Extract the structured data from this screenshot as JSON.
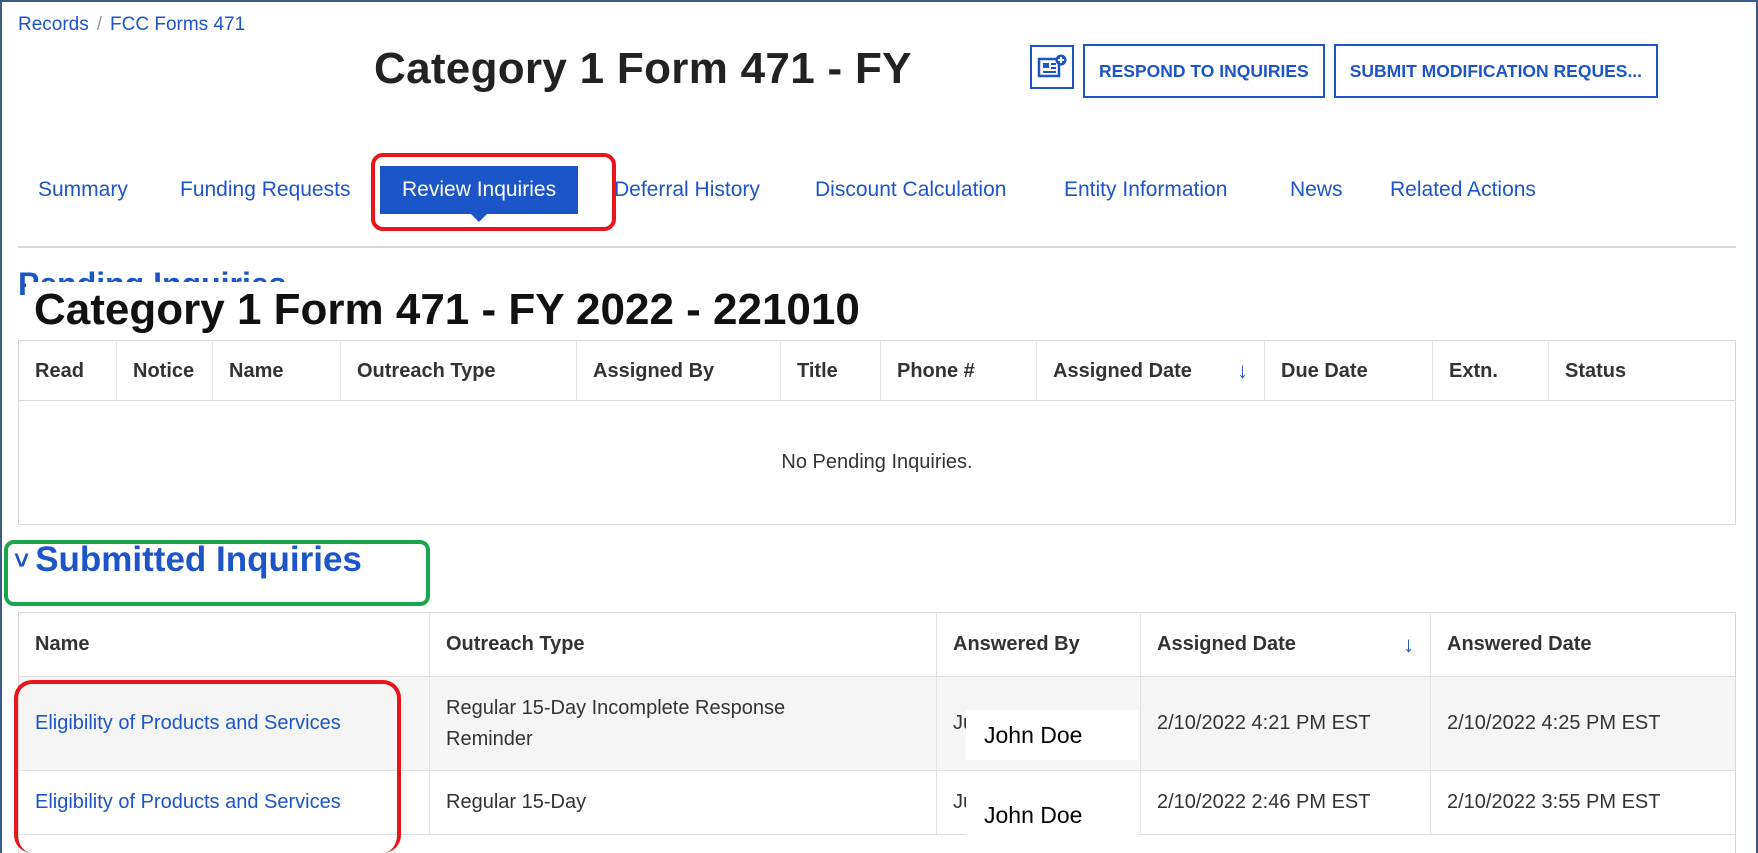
{
  "breadcrumb": {
    "root": "Records",
    "separator": "/",
    "current": "FCC Forms 471"
  },
  "page_title": "Category 1 Form 471 - FY",
  "overlay_title": "Category 1 Form 471 - FY 2022 - 221010",
  "actions": {
    "respond": "RESPOND TO INQUIRIES",
    "submit_mod": "SUBMIT MODIFICATION REQUES..."
  },
  "tabs": [
    {
      "label": "Summary"
    },
    {
      "label": "Funding Requests"
    },
    {
      "label": "Review Inquiries",
      "active": true
    },
    {
      "label": "Deferral History"
    },
    {
      "label": "Discount Calculation"
    },
    {
      "label": "Entity Information"
    },
    {
      "label": "News"
    },
    {
      "label": "Related Actions"
    }
  ],
  "pending": {
    "heading": "Pending Inquiries",
    "columns": [
      "Read",
      "Notice",
      "Name",
      "Outreach Type",
      "Assigned By",
      "Title",
      "Phone #",
      "Assigned Date",
      "Due Date",
      "Extn.",
      "Status"
    ],
    "sort_indicator": "↓",
    "empty_message": "No Pending Inquiries."
  },
  "submitted": {
    "chevron": "˅",
    "heading": "Submitted Inquiries",
    "columns": [
      "Name",
      "Outreach Type",
      "Answered By",
      "Assigned Date",
      "Answered Date"
    ],
    "sort_indicator": "↓",
    "rows": [
      {
        "name": "Eligibility of Products and Services",
        "outreach_type": "Regular 15-Day Incomplete Response Reminder",
        "answered_by_partial": "Ju",
        "answered_by": "John Doe",
        "assigned_date": "2/10/2022 4:21 PM EST",
        "answered_date": "2/10/2022 4:25 PM EST"
      },
      {
        "name": "Eligibility of Products and Services",
        "outreach_type": "Regular 15-Day",
        "answered_by_partial": "Ju",
        "answered_by": "John Doe",
        "assigned_date": "2/10/2022 2:46 PM EST",
        "answered_date": "2/10/2022 3:55 PM EST"
      }
    ]
  },
  "colors": {
    "accent": "#1b55c8",
    "highlight_red": "#e8151b",
    "highlight_green": "#1aa64a"
  }
}
